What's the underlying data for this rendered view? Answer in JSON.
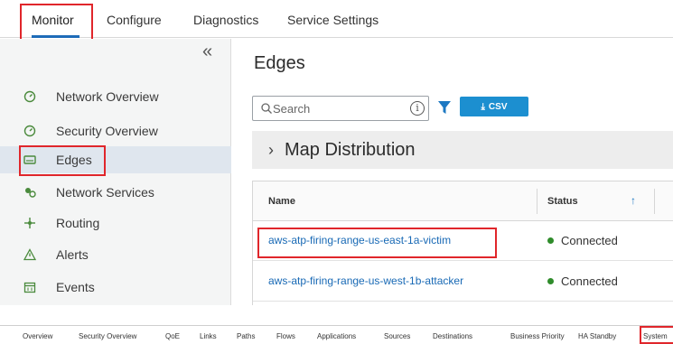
{
  "topnav": {
    "tabs": [
      {
        "label": "Monitor"
      },
      {
        "label": "Configure"
      },
      {
        "label": "Diagnostics"
      },
      {
        "label": "Service Settings"
      }
    ]
  },
  "sidebar": {
    "collapse_glyph": "«",
    "items": [
      {
        "label": "Network Overview",
        "icon": "gauge-icon"
      },
      {
        "label": "Security Overview",
        "icon": "gauge-icon"
      },
      {
        "label": "Edges",
        "icon": "edge-device-icon"
      },
      {
        "label": "Network Services",
        "icon": "network-services-icon"
      },
      {
        "label": "Routing",
        "icon": "routing-icon"
      },
      {
        "label": "Alerts",
        "icon": "alert-icon"
      },
      {
        "label": "Events",
        "icon": "calendar-icon"
      }
    ]
  },
  "main": {
    "title": "Edges",
    "search": {
      "placeholder": "Search"
    },
    "info_glyph": "i",
    "csv_label": "CSV",
    "csv_glyph": "⤓",
    "map_section": {
      "title": "Map Distribution",
      "chevron": "›"
    },
    "table": {
      "columns": [
        "Name",
        "Status"
      ],
      "sort_glyph": "↑",
      "rows": [
        {
          "name": "aws-atp-firing-range-us-east-1a-victim",
          "status": "Connected"
        },
        {
          "name": "aws-atp-firing-range-us-west-1b-attacker",
          "status": "Connected"
        }
      ]
    }
  },
  "bottom_tabs": [
    "Overview",
    "Security Overview",
    "QoE",
    "Links",
    "Paths",
    "Flows",
    "Applications",
    "Sources",
    "Destinations",
    "Business Priority",
    "HA Standby",
    "System"
  ],
  "colors": {
    "accent": "#1e6bb8",
    "highlight": "#e0262b",
    "csv_button": "#1c8fd0",
    "link": "#1869b5",
    "connected": "#2f8c2b"
  }
}
